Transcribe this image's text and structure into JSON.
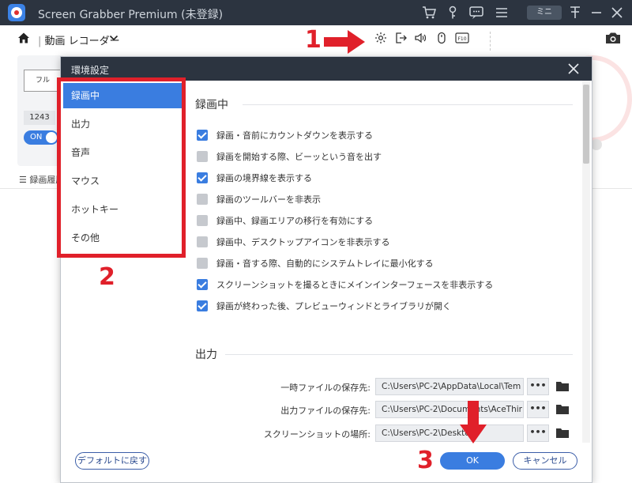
{
  "app": {
    "title": "Screen Grabber Premium (未登録)",
    "mini_label": "ミニ",
    "mode_label": "動画 レコーダー",
    "bg_full_label": "フル",
    "bg_width_value": "1243",
    "bg_toggle_label": "ON",
    "bg_history_label": "録画履歴"
  },
  "dialog": {
    "title": "環境設定",
    "nav": [
      {
        "label": "録画中",
        "active": true
      },
      {
        "label": "出力",
        "active": false
      },
      {
        "label": "音声",
        "active": false
      },
      {
        "label": "マウス",
        "active": false
      },
      {
        "label": "ホットキー",
        "active": false
      },
      {
        "label": "その他",
        "active": false
      }
    ],
    "recording": {
      "title": "録画中",
      "options": [
        {
          "label": "録画・音前にカウントダウンを表示する",
          "checked": true
        },
        {
          "label": "録画を開始する際、ビーッという音を出す",
          "checked": false
        },
        {
          "label": "録画の境界線を表示する",
          "checked": true
        },
        {
          "label": "録画のツールバーを非表示",
          "checked": false
        },
        {
          "label": "録画中、録画エリアの移行を有効にする",
          "checked": false
        },
        {
          "label": "録画中、デスクトップアイコンを非表示する",
          "checked": false
        },
        {
          "label": "録画・音する際、自動的にシステムトレイに最小化する",
          "checked": false
        },
        {
          "label": "スクリーンショットを撮るときにメインインターフェースを非表示する",
          "checked": true
        },
        {
          "label": "録画が終わった後、プレビューウィンドとライブラリが開く",
          "checked": true
        }
      ]
    },
    "output": {
      "title": "出力",
      "paths": [
        {
          "label": "一時ファイルの保存先:",
          "value": "C:\\Users\\PC-2\\AppData\\Local\\Tem"
        },
        {
          "label": "出力ファイルの保存先:",
          "value": "C:\\Users\\PC-2\\Documents\\AceThir"
        },
        {
          "label": "スクリーンショットの場所:",
          "value": "C:\\Users\\PC-2\\Desktop"
        }
      ],
      "browse_label": "•••"
    },
    "buttons": {
      "default": "デフォルトに戻す",
      "ok": "OK",
      "cancel": "キャンセル"
    }
  },
  "annotations": {
    "n1": "1",
    "n2": "2",
    "n3": "3"
  },
  "colors": {
    "accent": "#3a7de0",
    "annotation": "#e0202a",
    "titlebar": "#2c3440"
  }
}
